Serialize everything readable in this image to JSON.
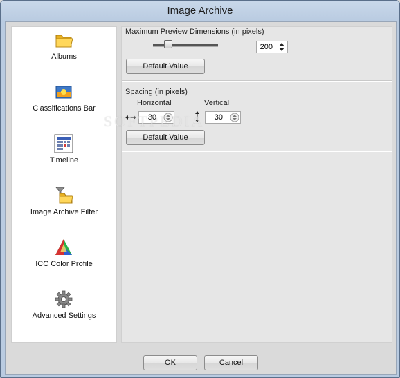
{
  "window": {
    "title": "Image Archive"
  },
  "sidebar": {
    "items": [
      {
        "label": "Albums",
        "icon": "folder-icon"
      },
      {
        "label": "Classifications Bar",
        "icon": "classifications-bar-icon"
      },
      {
        "label": "Timeline",
        "icon": "calendar-icon"
      },
      {
        "label": "Image Archive Filter",
        "icon": "filter-folder-icon"
      },
      {
        "label": "ICC Color Profile",
        "icon": "color-triangle-icon"
      },
      {
        "label": "Advanced Settings",
        "icon": "gear-icon"
      }
    ]
  },
  "preview": {
    "title": "Maximum Preview Dimensions (in pixels)",
    "slider_level_fraction": 0.2,
    "value": "200",
    "default_label": "Default Value"
  },
  "spacing": {
    "title": "Spacing (in pixels)",
    "horizontal_label": "Horizontal",
    "vertical_label": "Vertical",
    "horizontal_value": "30",
    "vertical_value": "30",
    "default_label": "Default Value"
  },
  "footer": {
    "ok_label": "OK",
    "cancel_label": "Cancel"
  },
  "watermark": "SOFTPEDIA"
}
